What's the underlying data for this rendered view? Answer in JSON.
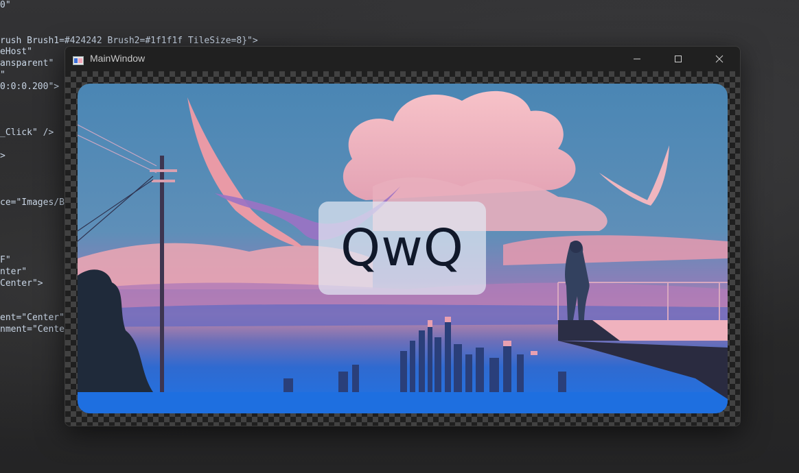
{
  "editor": {
    "top_line": "0\"",
    "brush_line": "rush Brush1=#424242 Brush2=#1f1f1f TileSize=8}\">",
    "lines": [
      "eHost\"",
      "ansparent\"",
      "\"",
      "0:0:0.200\">",
      "_Click\" />",
      ">",
      "ce=\"Images/B",
      "F\"",
      "nter\"",
      "Center\">",
      "ent=\"Center\"",
      "nment=\"Cente"
    ]
  },
  "window": {
    "title": "MainWindow",
    "minimize_glyph": "—",
    "maximize_glyph": "☐",
    "close_glyph": "✕"
  },
  "content": {
    "label": "QwQ"
  },
  "colors": {
    "checker_light": "#424242",
    "checker_dark": "#1f1f1f",
    "titlebar": "#202020"
  }
}
